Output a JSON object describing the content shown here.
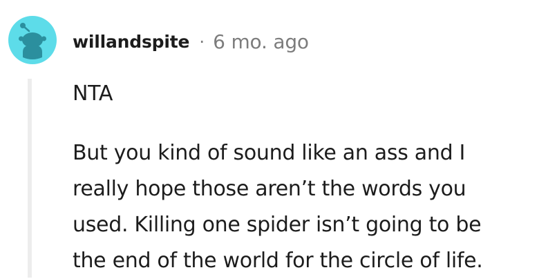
{
  "comment": {
    "author": "willandspite",
    "separator": "·",
    "timestamp": "6 mo. ago",
    "avatar_icon": "snoo-avatar-icon",
    "colors": {
      "avatar_bg": "#5ddce9",
      "avatar_figure": "#2b8f9e",
      "thread_line": "#ededed",
      "meta_text": "#7c7c7c",
      "body_text": "#1c1c1c"
    },
    "paragraphs": [
      {
        "lines": [
          "NTA"
        ]
      },
      {
        "lines": [
          "But you kind of sound like an ass and I",
          "really hope those aren’t the words you",
          "used. Killing one spider isn’t going to be",
          "the end of the world for the circle of life."
        ]
      }
    ]
  }
}
